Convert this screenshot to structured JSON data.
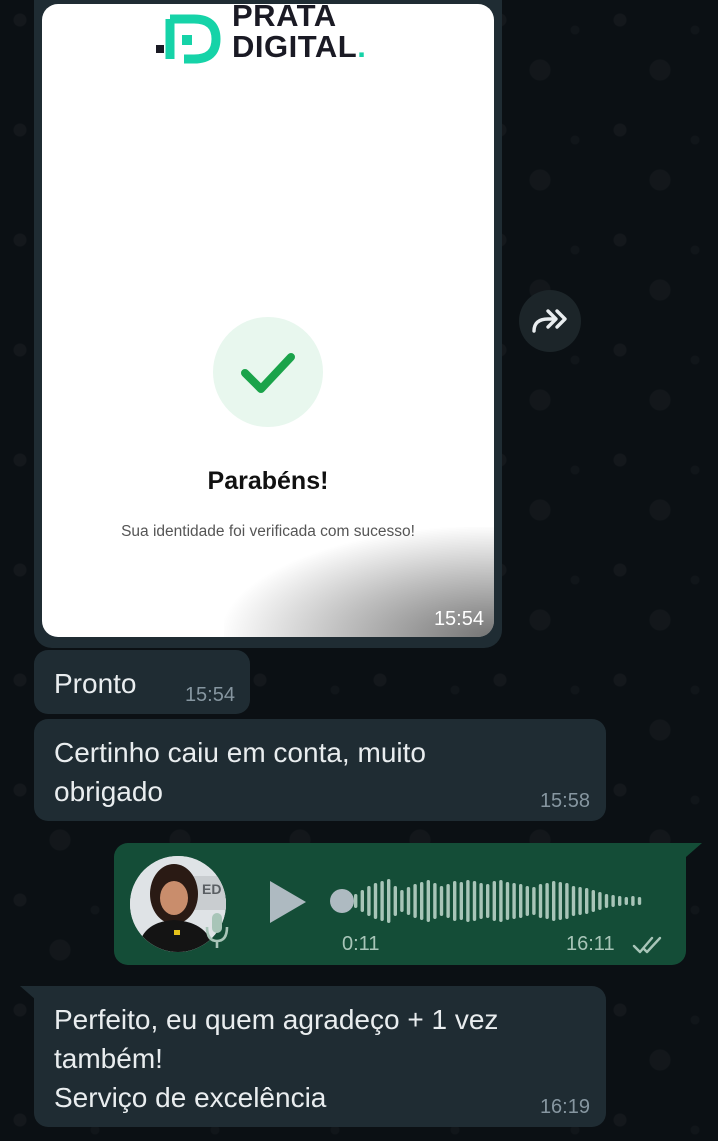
{
  "image_message": {
    "logo": {
      "line1": "PRATA",
      "line2": "DIGITAL",
      "brand_color": "#16d3a8"
    },
    "title": "Parabéns!",
    "subtitle": "Sua identidade foi verificada com sucesso!",
    "time": "15:54",
    "check_color": "#1aa34a"
  },
  "forward_icon": "double-forward-arrow-icon",
  "messages": [
    {
      "text": "Pronto",
      "time": "15:54"
    },
    {
      "text": "Certinho caiu em conta, muito\nobrigado",
      "time": "15:58"
    }
  ],
  "voice_message": {
    "duration": "0:11",
    "time": "16:11",
    "status": "read",
    "play_icon": "play-icon",
    "mic_icon": "mic-icon"
  },
  "last_message": {
    "text": "Perfeito, eu quem agradeço + 1 vez\ntambém!\nServiço de excelência",
    "time": "16:19"
  },
  "colors": {
    "background": "#0b1014",
    "incoming_bubble": "#1f2c33",
    "outgoing_bubble": "#144d37",
    "timestamp": "#8696a0"
  }
}
